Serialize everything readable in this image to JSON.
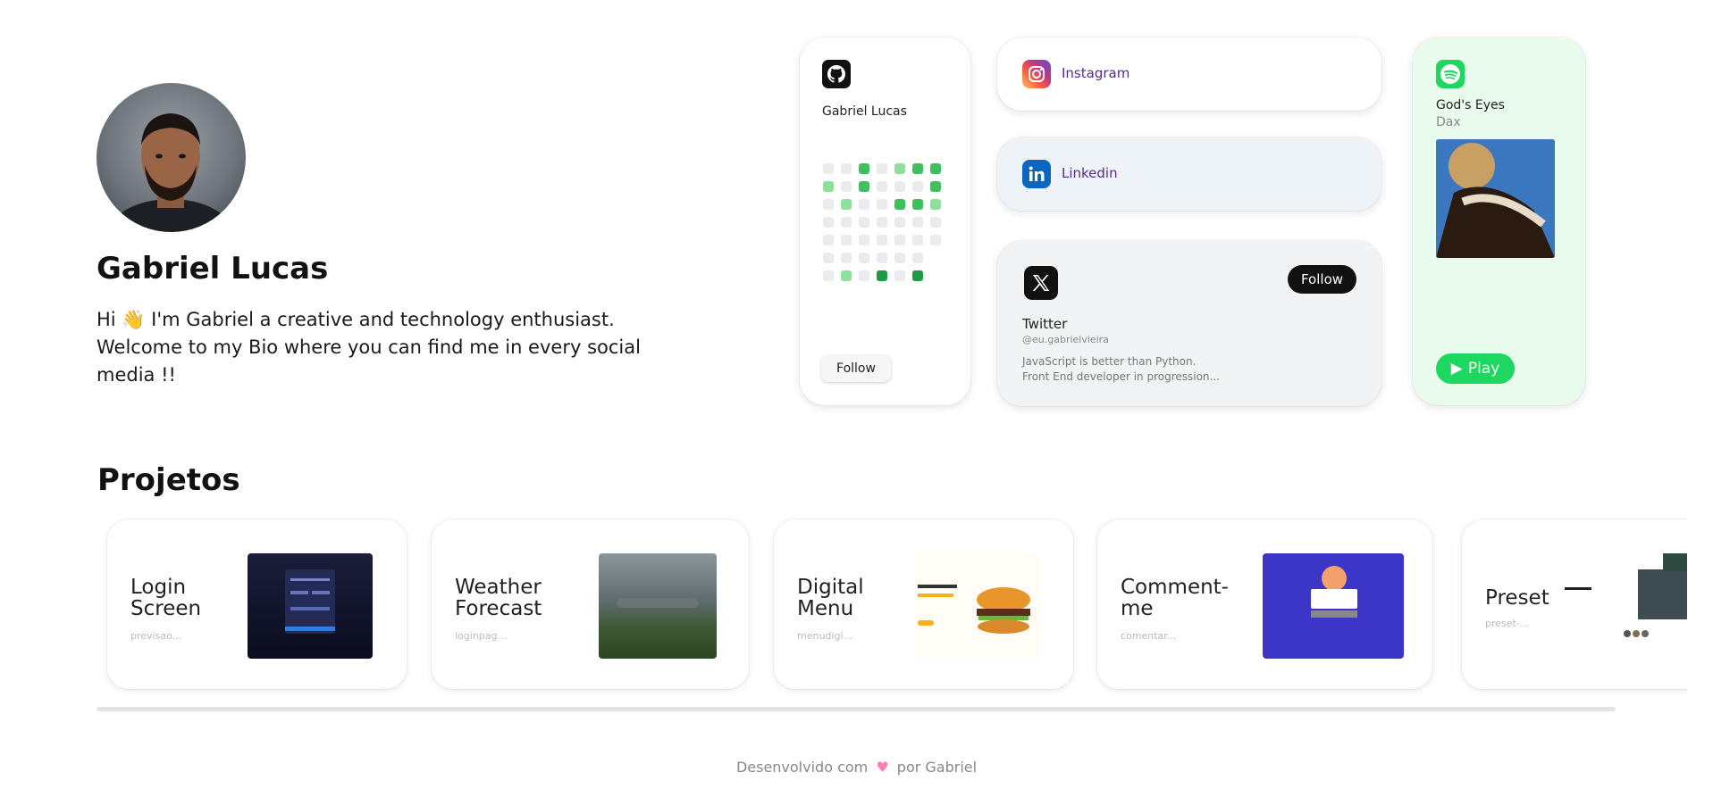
{
  "profile": {
    "name": "Gabriel Lucas",
    "bio": "Hi 👋 I'm Gabriel a creative and technology enthusiast. Welcome to my Bio where you can find me in every social media !!"
  },
  "github": {
    "icon": "github-icon",
    "name": "Gabriel Lucas",
    "follow_label": "Follow",
    "contributions": [
      [
        0,
        0,
        2,
        0,
        1,
        2,
        2
      ],
      [
        1,
        0,
        2,
        0,
        0,
        0,
        2
      ],
      [
        0,
        1,
        0,
        0,
        2,
        2,
        1
      ],
      [
        0,
        0,
        0,
        0,
        0,
        0,
        0
      ],
      [
        0,
        0,
        0,
        0,
        0,
        0,
        0
      ],
      [
        0,
        0,
        0,
        0,
        0,
        0,
        -1
      ],
      [
        0,
        1,
        0,
        3,
        0,
        3,
        -1
      ]
    ]
  },
  "instagram": {
    "icon": "instagram-icon",
    "label": "Instagram"
  },
  "linkedin": {
    "icon": "linkedin-icon",
    "label": "Linkedin"
  },
  "twitter": {
    "icon": "x-icon",
    "title": "Twitter",
    "handle": "@eu.gabrielvieira",
    "follow_label": "Follow",
    "desc_line1": "JavaScript is better than Python.",
    "desc_line2": "Front End developer in progression..."
  },
  "spotify": {
    "icon": "spotify-icon",
    "song": "God's Eyes",
    "artist": "Dax",
    "play_label": "Play"
  },
  "projects": {
    "title": "Projetos",
    "items": [
      {
        "name": "Login Screen",
        "slug": "previsao..."
      },
      {
        "name": "Weather Forecast",
        "slug": "loginpag..."
      },
      {
        "name": "Digital Menu",
        "slug": "menudigi..."
      },
      {
        "name": "Comment-me",
        "slug": "comentar..."
      },
      {
        "name": "Preset",
        "slug": "preset-..."
      }
    ]
  },
  "footer": {
    "before": "Desenvolvido com",
    "after": "por Gabriel"
  },
  "colors": {
    "github_green_light": "#8fdf9c",
    "github_green": "#3fbf5e",
    "github_green_dark": "#1e9a45",
    "spotify_green": "#1ed760",
    "linkedin_blue": "#0a66c2"
  }
}
